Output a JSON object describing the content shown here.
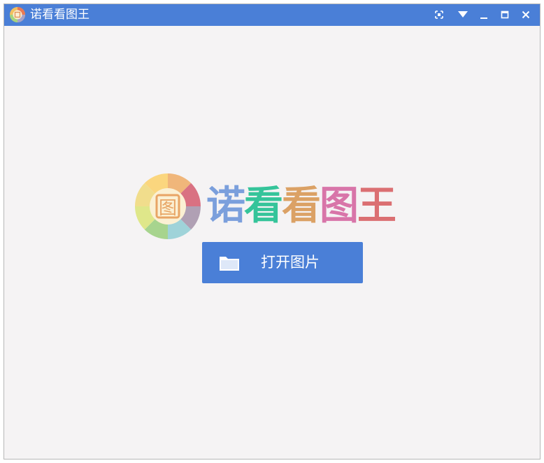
{
  "window": {
    "title": "诺看看图王",
    "title_bar_color": "#4a7fd7",
    "buttons": {
      "fullscreen_icon": "fullscreen-icon",
      "menu_icon": "dropdown-triangle-icon",
      "minimize_icon": "minimize-icon",
      "maximize_icon": "maximize-icon",
      "close_icon": "close-icon"
    }
  },
  "logo": {
    "chars": [
      "诺",
      "看",
      "看",
      "图",
      "王"
    ],
    "colors": [
      "#7b9fdc",
      "#35c49a",
      "#dba165",
      "#d875a9",
      "#db6f72"
    ],
    "badge_char": "图"
  },
  "open_button": {
    "label": "打开图片",
    "icon": "folder-icon"
  }
}
